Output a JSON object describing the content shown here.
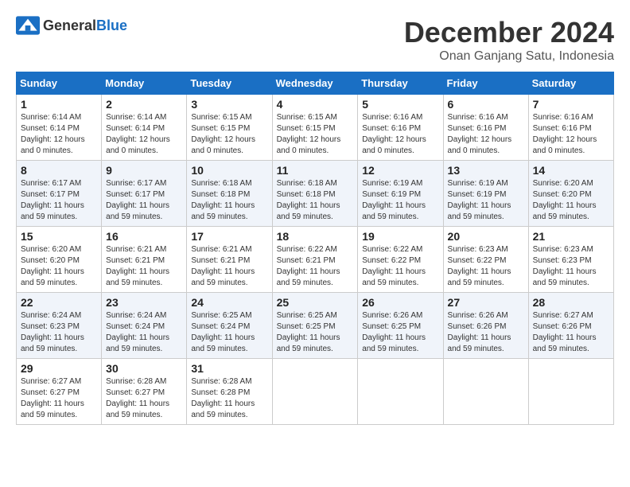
{
  "logo": {
    "general": "General",
    "blue": "Blue"
  },
  "header": {
    "month": "December 2024",
    "location": "Onan Ganjang Satu, Indonesia"
  },
  "weekdays": [
    "Sunday",
    "Monday",
    "Tuesday",
    "Wednesday",
    "Thursday",
    "Friday",
    "Saturday"
  ],
  "weeks": [
    [
      {
        "day": "1",
        "sunrise": "6:14 AM",
        "sunset": "6:14 PM",
        "daylight": "12 hours and 0 minutes."
      },
      {
        "day": "2",
        "sunrise": "6:14 AM",
        "sunset": "6:14 PM",
        "daylight": "12 hours and 0 minutes."
      },
      {
        "day": "3",
        "sunrise": "6:15 AM",
        "sunset": "6:15 PM",
        "daylight": "12 hours and 0 minutes."
      },
      {
        "day": "4",
        "sunrise": "6:15 AM",
        "sunset": "6:15 PM",
        "daylight": "12 hours and 0 minutes."
      },
      {
        "day": "5",
        "sunrise": "6:16 AM",
        "sunset": "6:16 PM",
        "daylight": "12 hours and 0 minutes."
      },
      {
        "day": "6",
        "sunrise": "6:16 AM",
        "sunset": "6:16 PM",
        "daylight": "12 hours and 0 minutes."
      },
      {
        "day": "7",
        "sunrise": "6:16 AM",
        "sunset": "6:16 PM",
        "daylight": "12 hours and 0 minutes."
      }
    ],
    [
      {
        "day": "8",
        "sunrise": "6:17 AM",
        "sunset": "6:17 PM",
        "daylight": "11 hours and 59 minutes."
      },
      {
        "day": "9",
        "sunrise": "6:17 AM",
        "sunset": "6:17 PM",
        "daylight": "11 hours and 59 minutes."
      },
      {
        "day": "10",
        "sunrise": "6:18 AM",
        "sunset": "6:18 PM",
        "daylight": "11 hours and 59 minutes."
      },
      {
        "day": "11",
        "sunrise": "6:18 AM",
        "sunset": "6:18 PM",
        "daylight": "11 hours and 59 minutes."
      },
      {
        "day": "12",
        "sunrise": "6:19 AM",
        "sunset": "6:19 PM",
        "daylight": "11 hours and 59 minutes."
      },
      {
        "day": "13",
        "sunrise": "6:19 AM",
        "sunset": "6:19 PM",
        "daylight": "11 hours and 59 minutes."
      },
      {
        "day": "14",
        "sunrise": "6:20 AM",
        "sunset": "6:20 PM",
        "daylight": "11 hours and 59 minutes."
      }
    ],
    [
      {
        "day": "15",
        "sunrise": "6:20 AM",
        "sunset": "6:20 PM",
        "daylight": "11 hours and 59 minutes."
      },
      {
        "day": "16",
        "sunrise": "6:21 AM",
        "sunset": "6:21 PM",
        "daylight": "11 hours and 59 minutes."
      },
      {
        "day": "17",
        "sunrise": "6:21 AM",
        "sunset": "6:21 PM",
        "daylight": "11 hours and 59 minutes."
      },
      {
        "day": "18",
        "sunrise": "6:22 AM",
        "sunset": "6:21 PM",
        "daylight": "11 hours and 59 minutes."
      },
      {
        "day": "19",
        "sunrise": "6:22 AM",
        "sunset": "6:22 PM",
        "daylight": "11 hours and 59 minutes."
      },
      {
        "day": "20",
        "sunrise": "6:23 AM",
        "sunset": "6:22 PM",
        "daylight": "11 hours and 59 minutes."
      },
      {
        "day": "21",
        "sunrise": "6:23 AM",
        "sunset": "6:23 PM",
        "daylight": "11 hours and 59 minutes."
      }
    ],
    [
      {
        "day": "22",
        "sunrise": "6:24 AM",
        "sunset": "6:23 PM",
        "daylight": "11 hours and 59 minutes."
      },
      {
        "day": "23",
        "sunrise": "6:24 AM",
        "sunset": "6:24 PM",
        "daylight": "11 hours and 59 minutes."
      },
      {
        "day": "24",
        "sunrise": "6:25 AM",
        "sunset": "6:24 PM",
        "daylight": "11 hours and 59 minutes."
      },
      {
        "day": "25",
        "sunrise": "6:25 AM",
        "sunset": "6:25 PM",
        "daylight": "11 hours and 59 minutes."
      },
      {
        "day": "26",
        "sunrise": "6:26 AM",
        "sunset": "6:25 PM",
        "daylight": "11 hours and 59 minutes."
      },
      {
        "day": "27",
        "sunrise": "6:26 AM",
        "sunset": "6:26 PM",
        "daylight": "11 hours and 59 minutes."
      },
      {
        "day": "28",
        "sunrise": "6:27 AM",
        "sunset": "6:26 PM",
        "daylight": "11 hours and 59 minutes."
      }
    ],
    [
      {
        "day": "29",
        "sunrise": "6:27 AM",
        "sunset": "6:27 PM",
        "daylight": "11 hours and 59 minutes."
      },
      {
        "day": "30",
        "sunrise": "6:28 AM",
        "sunset": "6:27 PM",
        "daylight": "11 hours and 59 minutes."
      },
      {
        "day": "31",
        "sunrise": "6:28 AM",
        "sunset": "6:28 PM",
        "daylight": "11 hours and 59 minutes."
      },
      null,
      null,
      null,
      null
    ]
  ],
  "labels": {
    "sunrise": "Sunrise:",
    "sunset": "Sunset:",
    "daylight": "Daylight:"
  }
}
